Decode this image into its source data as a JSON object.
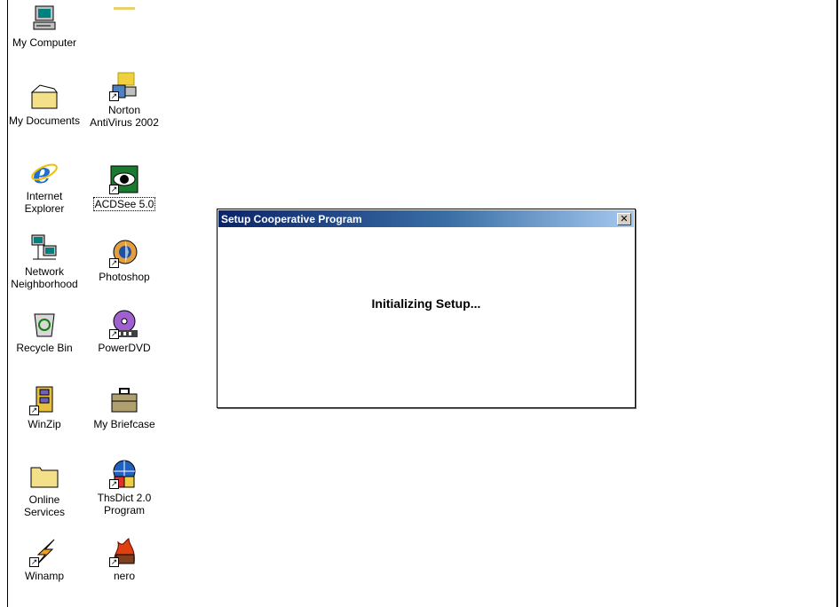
{
  "desktop": {
    "icons": [
      {
        "label": "My Computer"
      },
      {
        "label": "My Documents"
      },
      {
        "label": "Norton\nAntiVirus 2002"
      },
      {
        "label": "Internet\nExplorer"
      },
      {
        "label": "ACDSee 5.0"
      },
      {
        "label": "Network\nNeighborhood"
      },
      {
        "label": "Photoshop"
      },
      {
        "label": "Recycle Bin"
      },
      {
        "label": "PowerDVD"
      },
      {
        "label": "WinZip"
      },
      {
        "label": "My Briefcase"
      },
      {
        "label": "Online\nServices"
      },
      {
        "label": "ThsDict 2.0\nProgram"
      },
      {
        "label": "Winamp"
      },
      {
        "label": "nero"
      }
    ]
  },
  "dialog": {
    "title": "Setup Cooperative Program",
    "close_glyph": "✕",
    "message": "Initializing Setup..."
  },
  "colors": {
    "title_start": "#0a246a",
    "title_end": "#a6caf0",
    "desktop": "#ffffff"
  }
}
